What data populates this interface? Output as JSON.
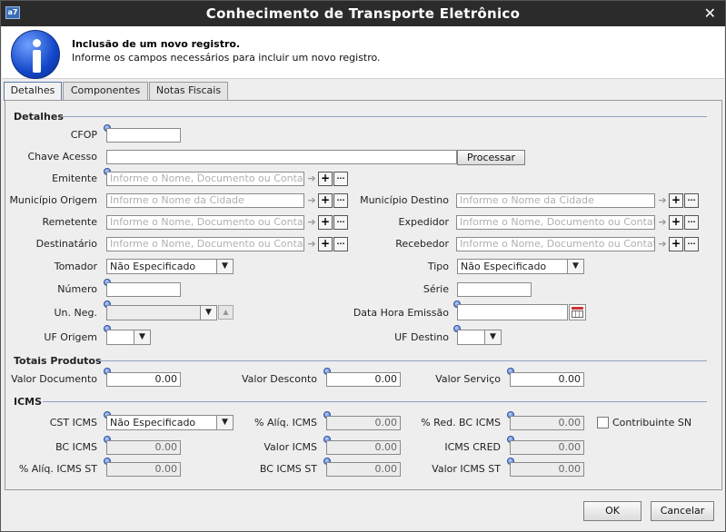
{
  "window": {
    "title": "Conhecimento de Transporte Eletrônico",
    "app_icon": "a7",
    "close_glyph": "✕"
  },
  "header": {
    "title": "Inclusão de um novo registro.",
    "subtitle": "Informe os campos necessários para incluir um novo registro."
  },
  "tabs": [
    "Detalhes",
    "Componentes",
    "Notas Fiscais"
  ],
  "sections": {
    "detalhes": "Detalhes",
    "totais": "Totais Produtos",
    "icms": "ICMS"
  },
  "ph_entity": "Informe o Nome, Documento ou Contato",
  "ph_city": "Informe o Nome da Cidade",
  "detalhes": {
    "cfop": {
      "label": "CFOP",
      "value": ""
    },
    "chave": {
      "label": "Chave Acesso",
      "value": "",
      "button": "Processar"
    },
    "emitente": "Emitente",
    "mun_origem": "Município Origem",
    "mun_destino": "Município Destino",
    "remetente": "Remetente",
    "expedidor": "Expedidor",
    "destinatario": "Destinatário",
    "recebedor": "Recebedor",
    "tomador": {
      "label": "Tomador",
      "value": "Não Especificado"
    },
    "tipo": {
      "label": "Tipo",
      "value": "Não Especificado"
    },
    "numero": {
      "label": "Número",
      "value": ""
    },
    "serie": {
      "label": "Série",
      "value": ""
    },
    "un_neg": {
      "label": "Un. Neg.",
      "value": ""
    },
    "data_emissao": {
      "label": "Data Hora Emissão",
      "value": ""
    },
    "uf_origem": {
      "label": "UF Origem",
      "value": ""
    },
    "uf_destino": {
      "label": "UF Destino",
      "value": ""
    }
  },
  "totais": {
    "valor_documento": {
      "label": "Valor Documento",
      "value": "0.00"
    },
    "valor_desconto": {
      "label": "Valor Desconto",
      "value": "0.00"
    },
    "valor_servico": {
      "label": "Valor Serviço",
      "value": "0.00"
    }
  },
  "icms": {
    "cst": {
      "label": "CST ICMS",
      "value": "Não Especificado"
    },
    "aliq": {
      "label": "% Alíq. ICMS",
      "value": "0.00"
    },
    "red_bc": {
      "label": "% Red. BC ICMS",
      "value": "0.00"
    },
    "contribuinte": {
      "label": "Contribuinte SN",
      "checked": false
    },
    "bc": {
      "label": "BC ICMS",
      "value": "0.00"
    },
    "valor": {
      "label": "Valor ICMS",
      "value": "0.00"
    },
    "cred": {
      "label": "ICMS CRED",
      "value": "0.00"
    },
    "aliq_st": {
      "label": "% Alíq. ICMS ST",
      "value": "0.00"
    },
    "bc_st": {
      "label": "BC ICMS ST",
      "value": "0.00"
    },
    "valor_st": {
      "label": "Valor ICMS ST",
      "value": "0.00"
    }
  },
  "buttons": {
    "ok": "OK",
    "cancel": "Cancelar"
  },
  "glyphs": {
    "add": "+",
    "more": "···",
    "go": "➔",
    "down": "▼",
    "up": "▲"
  },
  "colors": {
    "titlebar": "#2b2b2b",
    "info_icon": "#1346c8",
    "section_line": "#8fa3c4"
  }
}
